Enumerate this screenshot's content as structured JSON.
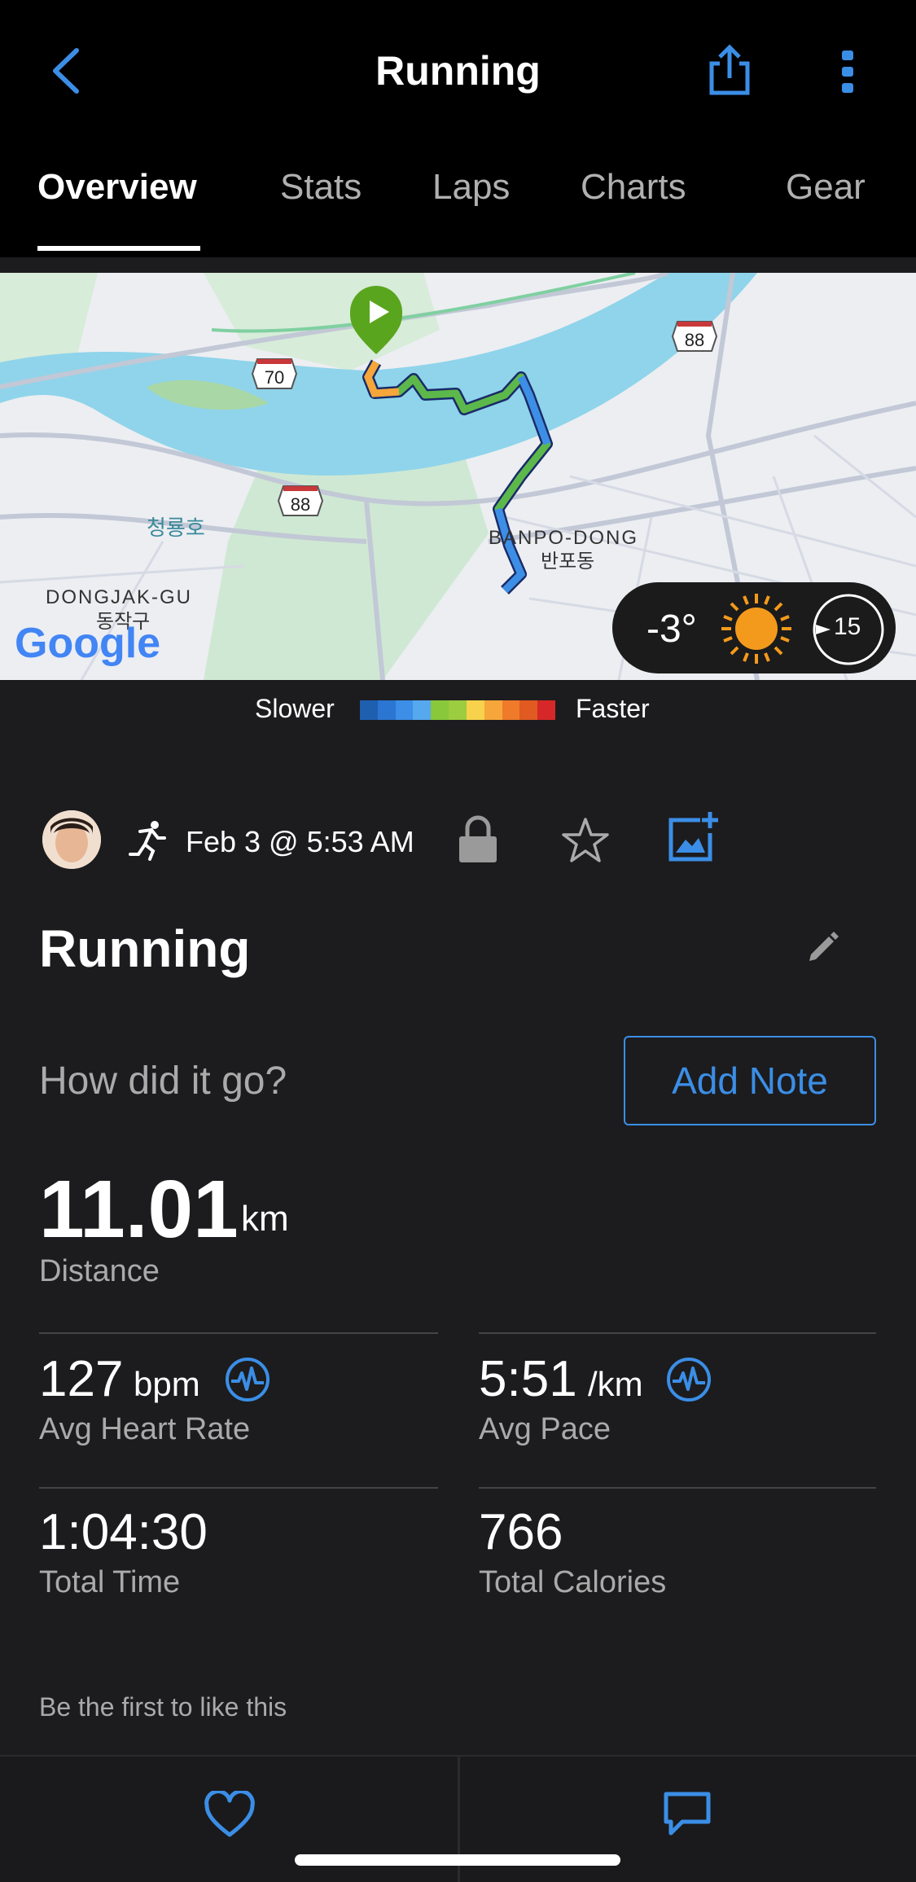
{
  "header": {
    "title": "Running"
  },
  "tabs": [
    "Overview",
    "Stats",
    "Laps",
    "Charts",
    "Gear"
  ],
  "map": {
    "labels": {
      "road_70": "70",
      "road_88a": "88",
      "road_88b": "88",
      "lake": "청룡호",
      "district": "DONGJAK-GU",
      "district_kr": "동작구",
      "neighborhood": "BANPO-DONG",
      "neighborhood_kr": "반포동",
      "google": "Google"
    },
    "weather": {
      "temp": "-3°",
      "wind": "15"
    }
  },
  "legend": {
    "slower": "Slower",
    "faster": "Faster",
    "colors": [
      "#1f5fb0",
      "#2a76d2",
      "#3d8ee6",
      "#56a8ef",
      "#88c83a",
      "#9ccc40",
      "#f7d24a",
      "#f6a63a",
      "#ee7a2a",
      "#e05a22",
      "#d62828"
    ]
  },
  "activity": {
    "date": "Feb 3 @ 5:53 AM",
    "title": "Running",
    "prompt": "How did it go?",
    "add_note": "Add Note"
  },
  "stats": {
    "distance": {
      "value": "11.01",
      "unit": "km",
      "label": "Distance"
    },
    "heart_rate": {
      "value": "127",
      "unit": "bpm",
      "label": "Avg Heart Rate"
    },
    "pace": {
      "value": "5:51",
      "unit": "/km",
      "label": "Avg Pace"
    },
    "time": {
      "value": "1:04:30",
      "label": "Total Time"
    },
    "calories": {
      "value": "766",
      "label": "Total Calories"
    }
  },
  "social": {
    "likes_text": "Be the first to like this"
  },
  "colors": {
    "accent": "#3b8ee6",
    "bg": "#1c1c1e",
    "route_start": "#5aa51e"
  }
}
